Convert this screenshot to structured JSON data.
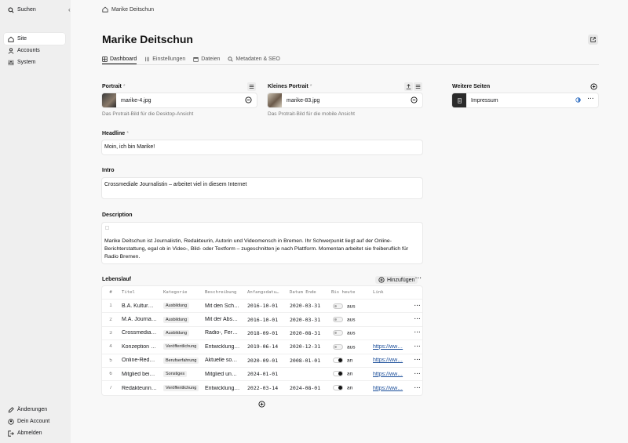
{
  "sidebar": {
    "search_label": "Suchen",
    "nav": [
      {
        "label": "Site",
        "icon": "home-icon",
        "active": true
      },
      {
        "label": "Accounts",
        "icon": "users-icon"
      },
      {
        "label": "System",
        "icon": "sliders-icon"
      }
    ],
    "bottom": [
      {
        "label": "Änderungen",
        "icon": "pencil-icon"
      },
      {
        "label": "Dein Account",
        "icon": "account-icon"
      },
      {
        "label": "Abmelden",
        "icon": "logout-icon"
      }
    ]
  },
  "breadcrumb": {
    "label": "Marike Deitschun"
  },
  "page": {
    "title": "Marike Deitschun"
  },
  "tabs": [
    {
      "label": "Dashboard",
      "icon": "grid-icon",
      "active": true
    },
    {
      "label": "Einstellungen",
      "icon": "sliders-icon"
    },
    {
      "label": "Dateien",
      "icon": "folder-icon"
    },
    {
      "label": "Metadaten & SEO",
      "icon": "search-icon"
    }
  ],
  "portrait": {
    "label": "Portrait",
    "required": "*",
    "file": "marike-4.jpg",
    "help": "Das Protrait-Bild für die Desktop-Ansicht"
  },
  "small_portrait": {
    "label": "Kleines Portrait",
    "required": "*",
    "file": "marike-83.jpg",
    "help": "Das Protrait-Bild für die mobile Ansicht"
  },
  "more_pages": {
    "label": "Weitere Seiten",
    "page": "Impressum"
  },
  "headline": {
    "label": "Headline",
    "required": "*",
    "value": "Moin, ich bin Marike!"
  },
  "intro": {
    "label": "Intro",
    "value": "Crossmediale Journalistin – arbeitet viel in diesem Internet"
  },
  "description": {
    "label": "Description",
    "value": "Marike Deitschun ist Journalistin, Redakteurin, Autorin und Videomensch in Bremen. Ihr Schwerpunkt liegt auf der Online-Berichterstattung, egal ob in Video-, Bild- oder Textform – zugeschnitten je nach Plattform. Momentan arbeitet sie freiberuflich für Radio Bremen."
  },
  "lebenslauf": {
    "label": "Lebenslauf",
    "add_label": "Hinzufügen",
    "columns": [
      "#",
      "Titel",
      "Kategorie",
      "Beschreibung",
      "Anfangsdatu…",
      "Datum Ende",
      "Bis heute",
      "Link"
    ],
    "rows": [
      {
        "n": "1",
        "titel": "B.A. Kultur…",
        "kategorie": "Ausbildung",
        "beschreibung": "Mit den Sch…",
        "start": "2016-10-01",
        "ende": "2020-03-31",
        "bis_heute": "aus",
        "on": false,
        "link": ""
      },
      {
        "n": "2",
        "titel": "M.A. Journa…",
        "kategorie": "Ausbildung",
        "beschreibung": "Mit der Abs…",
        "start": "2016-10-01",
        "ende": "2020-03-31",
        "bis_heute": "aus",
        "on": false,
        "link": ""
      },
      {
        "n": "3",
        "titel": "Crossmedia…",
        "kategorie": "Ausbildung",
        "beschreibung": "Radio-, Fer…",
        "start": "2018-09-01",
        "ende": "2020-08-31",
        "bis_heute": "aus",
        "on": false,
        "link": ""
      },
      {
        "n": "4",
        "titel": "Konzeption …",
        "kategorie": "Veröffentlichung",
        "beschreibung": "Entwicklung…",
        "start": "2019-06-14",
        "ende": "2020-12-31",
        "bis_heute": "aus",
        "on": false,
        "link": "https://ww…"
      },
      {
        "n": "5",
        "titel": "Online-Red…",
        "kategorie": "Berufserfahrung",
        "beschreibung": "Aktuelle so…",
        "start": "2020-09-01",
        "ende": "2008-01-01",
        "bis_heute": "an",
        "on": true,
        "link": "https://ww…"
      },
      {
        "n": "6",
        "titel": "Mitglied bei…",
        "kategorie": "Sonstiges",
        "beschreibung": "Mitglied un…",
        "start": "2024-01-01",
        "ende": "",
        "bis_heute": "an",
        "on": true,
        "link": "https://ww…"
      },
      {
        "n": "7",
        "titel": "Redakteurin…",
        "kategorie": "Veröffentlichung",
        "beschreibung": "Entwicklung…",
        "start": "2022-03-14",
        "ende": "2024-08-01",
        "bis_heute": "an",
        "on": true,
        "link": "https://ww…"
      }
    ]
  }
}
